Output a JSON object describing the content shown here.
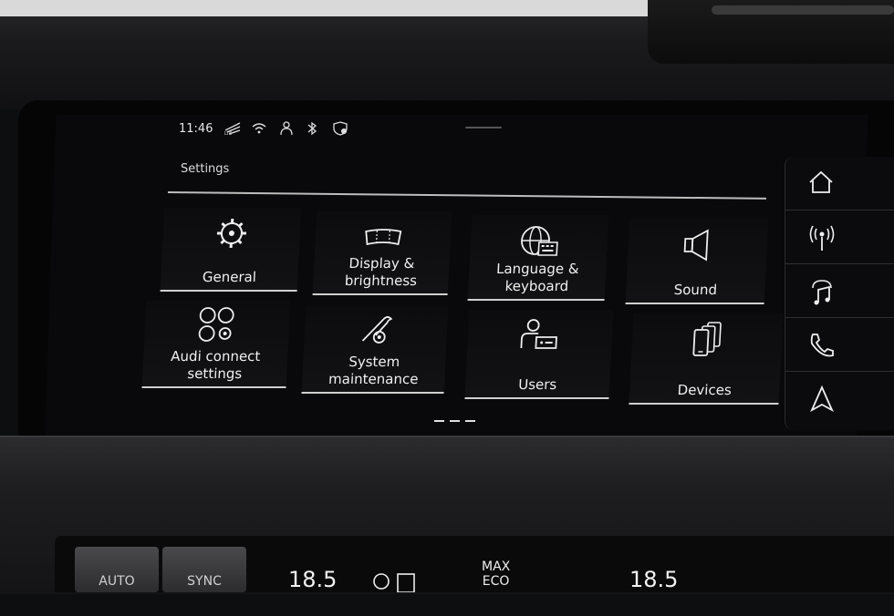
{
  "status_bar": {
    "time": "11:46",
    "icons": [
      "lte-signal-icon",
      "wifi-icon",
      "user-profile-icon",
      "bluetooth-icon",
      "privacy-shield-icon"
    ]
  },
  "header": {
    "title": "Settings"
  },
  "tiles": [
    {
      "id": "general",
      "label": "General",
      "icon": "gear-icon"
    },
    {
      "id": "display",
      "label": "Display & brightness",
      "icon": "display-icon"
    },
    {
      "id": "language",
      "label": "Language & keyboard",
      "icon": "globe-keyboard-icon"
    },
    {
      "id": "sound",
      "label": "Sound",
      "icon": "speaker-icon"
    },
    {
      "id": "audi-connect",
      "label": "Audi connect settings",
      "icon": "connect-gears-icon"
    },
    {
      "id": "system",
      "label": "System maintenance",
      "icon": "wrench-gear-icon"
    },
    {
      "id": "users",
      "label": "Users",
      "icon": "users-icon"
    },
    {
      "id": "devices",
      "label": "Devices",
      "icon": "devices-icon"
    }
  ],
  "pager": {
    "pages": 3
  },
  "side_nav": [
    "home-icon",
    "radio-icon",
    "media-icon",
    "phone-icon",
    "navigation-icon"
  ],
  "climate": {
    "auto_label": "AUTO",
    "sync_label": "SYNC",
    "temp_left": "18.5",
    "max_label": "MAX",
    "eco_label": "ECO",
    "temp_right": "18.5"
  }
}
